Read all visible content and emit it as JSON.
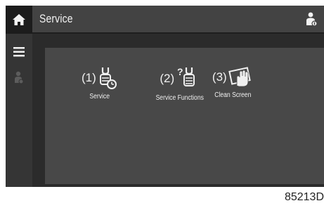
{
  "header": {
    "title": "Service"
  },
  "items": [
    {
      "number": "(1)",
      "label": "Service",
      "icon": "wrench-timer-icon"
    },
    {
      "number": "(2)",
      "label": "Service Functions",
      "icon": "wrench-question-icon"
    },
    {
      "number": "(3)",
      "label": "Clean Screen",
      "icon": "hand-wipe-icon"
    }
  ],
  "rail_icons": [
    "home-icon",
    "menu-icon",
    "user-icon"
  ],
  "header_icon": "user-access-icon",
  "figure_code": "85213D",
  "colors": {
    "screen_bg": "#2b2b2b",
    "content_bg": "#484848",
    "header_bg": "#434343",
    "text": "#f0f0f0"
  }
}
